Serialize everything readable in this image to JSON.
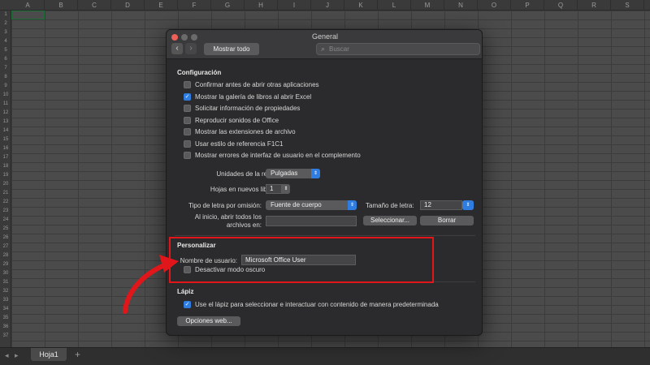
{
  "spreadsheet": {
    "columns": [
      "A",
      "B",
      "C",
      "D",
      "E",
      "F",
      "G",
      "H",
      "I",
      "J",
      "K",
      "L",
      "M",
      "N",
      "O",
      "P",
      "Q",
      "R",
      "S"
    ],
    "rows": [
      "1",
      "2",
      "3",
      "4",
      "5",
      "6",
      "7",
      "8",
      "9",
      "10",
      "11",
      "12",
      "13",
      "14",
      "15",
      "16",
      "17",
      "18",
      "19",
      "20",
      "21",
      "22",
      "23",
      "24",
      "25",
      "26",
      "27",
      "28",
      "29",
      "30",
      "31",
      "32",
      "33",
      "34",
      "35",
      "36",
      "37"
    ],
    "sheet_tab": "Hoja1",
    "add_tab": "+"
  },
  "dialog": {
    "title": "General",
    "back": "‹",
    "forward": "›",
    "show_all": "Mostrar todo",
    "search_placeholder": "Buscar"
  },
  "configuracion": {
    "title": "Configuración",
    "options": [
      {
        "label": "Confirmar antes de abrir otras aplicaciones",
        "checked": false
      },
      {
        "label": "Mostrar la galería de libros al abrir Excel",
        "checked": true
      },
      {
        "label": "Solicitar información de propiedades",
        "checked": false
      },
      {
        "label": "Reproducir sonidos de Office",
        "checked": false
      },
      {
        "label": "Mostrar las extensiones de archivo",
        "checked": false
      },
      {
        "label": "Usar estilo de referencia F1C1",
        "checked": false
      },
      {
        "label": "Mostrar errores de interfaz de usuario en el complemento",
        "checked": false
      }
    ],
    "ruler_units_label": "Unidades de la regla:",
    "ruler_units_value": "Pulgadas",
    "sheets_label": "Hojas en nuevos libros:",
    "sheets_value": "1",
    "font_label": "Tipo de letra por omisión:",
    "font_value": "Fuente de cuerpo",
    "font_size_label": "Tamaño de letra:",
    "font_size_value": "12",
    "startup_label_1": "Al inicio, abrir todos los",
    "startup_label_2": "archivos en:",
    "select_button": "Seleccionar...",
    "clear_button": "Borrar"
  },
  "personalizar": {
    "title": "Personalizar",
    "username_label": "Nombre de usuario:",
    "username_value": "Microsoft Office User",
    "dark_mode_label": "Desactivar modo oscuro",
    "dark_mode_checked": false
  },
  "lapiz": {
    "title": "Lápiz",
    "pen_label": "Use el lápiz para seleccionar e interactuar con contenido de manera predeterminada",
    "pen_checked": true,
    "web_options_button": "Opciones web..."
  },
  "colors": {
    "highlight": "#e0161b",
    "accent": "#2f7de0"
  }
}
